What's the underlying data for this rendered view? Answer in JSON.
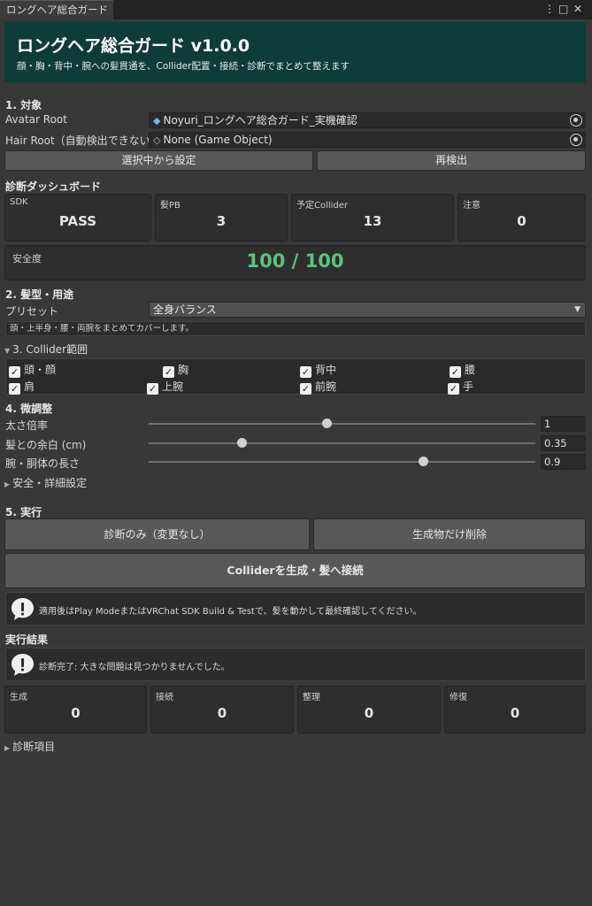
{
  "window": {
    "tab_title": "ロングヘア総合ガード",
    "menu_icon": "⋮",
    "maximize_icon": "□",
    "close_icon": "✕"
  },
  "header": {
    "title": "ロングヘア総合ガード  v1.0.0",
    "subtitle": "顔・胸・背中・腕への髪貫通を、Collider配置・接続・診断でまとめて整えます",
    "color": "#0e3c37"
  },
  "target": {
    "heading": "1. 対象",
    "avatar_root_label": "Avatar Root",
    "avatar_root_value": "Noyuri_ロングヘア総合ガード_実機確認",
    "hair_root_label": "Hair Root（自動検出できない",
    "hair_root_value": "None (Game Object)",
    "set_from_selection": "選択中から設定",
    "redetect": "再検出"
  },
  "dashboard": {
    "heading": "診断ダッシュボード",
    "cards": [
      {
        "caption": "SDK",
        "value": "PASS"
      },
      {
        "caption": "髪PB",
        "value": "3"
      },
      {
        "caption": "予定Collider",
        "value": "13"
      },
      {
        "caption": "注意",
        "value": "0"
      }
    ],
    "safety_caption": "安全度",
    "safety_value": "100 / 100",
    "safety_color": "#5fc17c"
  },
  "style": {
    "heading": "2. 髪型・用途",
    "preset_label": "プリセット",
    "preset_value": "全身バランス",
    "preset_help": "頭・上半身・腰・両腕をまとめてカバーします。"
  },
  "range": {
    "heading": "3. Collider範囲",
    "items": [
      "頭・顔",
      "胸",
      "背中",
      "腰",
      "肩",
      "上腕",
      "前腕",
      "手"
    ]
  },
  "tuning": {
    "heading": "4. 微調整",
    "sliders": [
      {
        "label": "太さ倍率",
        "value": "1",
        "fill": 0.46
      },
      {
        "label": "髪との余白 (cm)",
        "value": "0.35",
        "fill": 0.24
      },
      {
        "label": "腕・胴体の長さ",
        "value": "0.9",
        "fill": 0.71
      }
    ],
    "advanced_foldout": "安全・詳細設定"
  },
  "run": {
    "heading": "5. 実行",
    "diagnose_only": "診断のみ（変更なし）",
    "delete_generated": "生成物だけ削除",
    "generate_connect": "Colliderを生成・髪へ接続",
    "notice": "適用後はPlay ModeまたはVRChat SDK Build & Testで、髪を動かして最終確認してください。"
  },
  "result": {
    "heading": "実行結果",
    "message": "診断完了: 大きな問題は見つかりませんでした。",
    "cards": [
      {
        "caption": "生成",
        "value": "0"
      },
      {
        "caption": "接続",
        "value": "0"
      },
      {
        "caption": "整理",
        "value": "0"
      },
      {
        "caption": "修復",
        "value": "0"
      }
    ],
    "items_foldout": "診断項目"
  }
}
